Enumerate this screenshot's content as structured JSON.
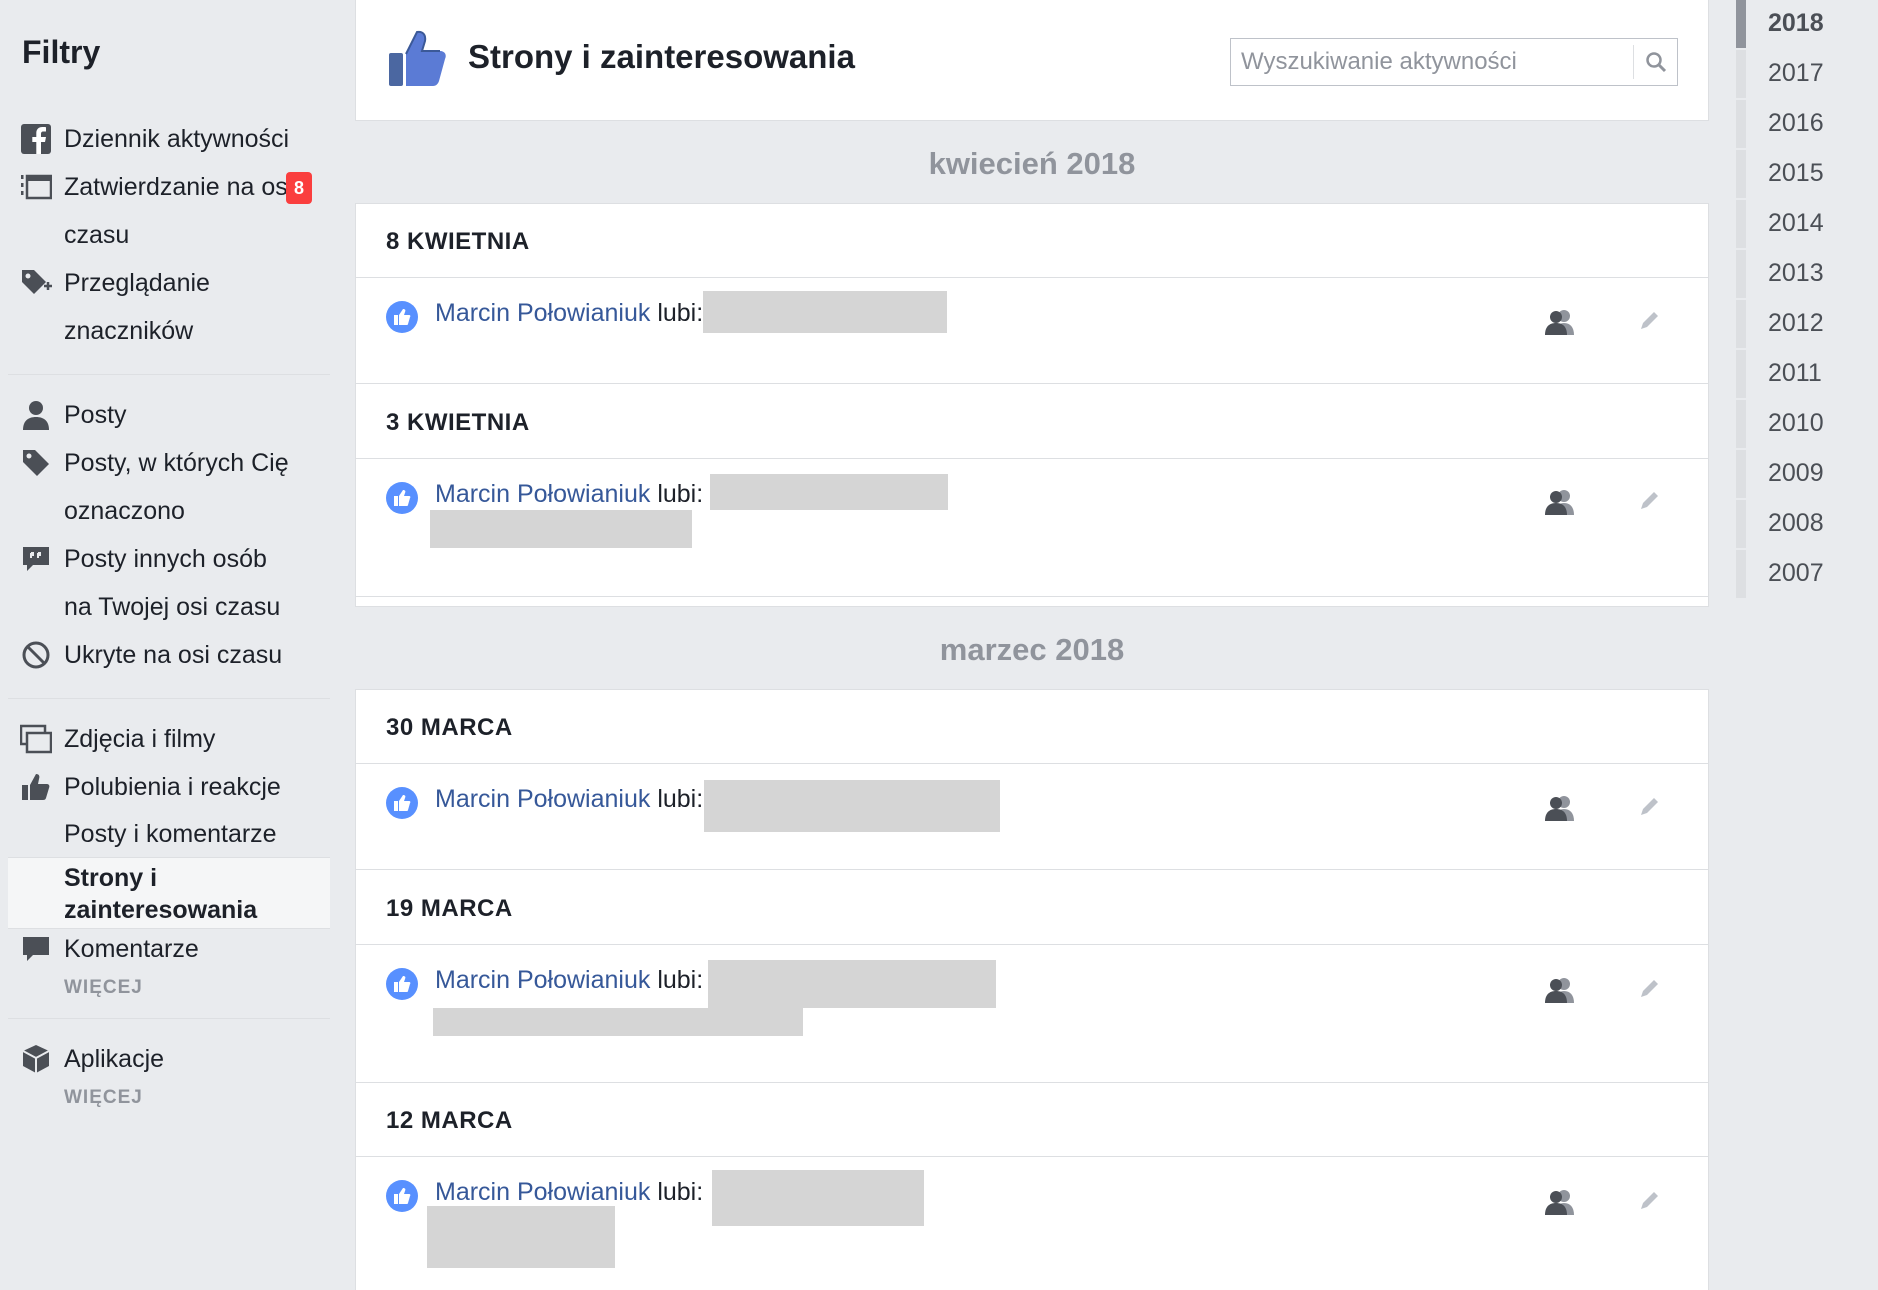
{
  "sidebar": {
    "title": "Filtry",
    "group1": [
      {
        "label": "Dziennik aktywności",
        "icon": "facebook-icon"
      },
      {
        "label": "Zatwierdzanie na osi czasu",
        "icon": "timeline-review-icon",
        "badge": "8"
      },
      {
        "label": "Przeglądanie znaczników",
        "icon": "tag-review-icon"
      }
    ],
    "group2": [
      {
        "label": "Posty",
        "icon": "person-icon"
      },
      {
        "label": "Posty, w których Cię oznaczono",
        "icon": "tag-icon"
      },
      {
        "label": "Posty innych osób na Twojej osi czasu",
        "icon": "quote-bubble-icon"
      },
      {
        "label": "Ukryte na osi czasu",
        "icon": "hidden-icon"
      }
    ],
    "group3": [
      {
        "label": "Zdjęcia i filmy",
        "icon": "photos-icon"
      },
      {
        "label": "Polubienia i reakcje",
        "icon": "like-icon"
      }
    ],
    "likes_sub": [
      {
        "label": "Posty i komentarze"
      },
      {
        "label": "Strony i zainteresowania",
        "active": true
      }
    ],
    "comments": {
      "label": "Komentarze",
      "icon": "comment-icon"
    },
    "more1": "WIĘCEJ",
    "apps": {
      "label": "Aplikacje",
      "icon": "apps-cube-icon"
    },
    "more2": "WIĘCEJ"
  },
  "header": {
    "title": "Strony i zainteresowania",
    "search_placeholder": "Wyszukiwanie aktywności"
  },
  "months": [
    {
      "label": "kwiecień 2018",
      "days": [
        {
          "date": "8 KWIETNIA",
          "entries": [
            {
              "actor": "Marcin Połowianiuk",
              "verb": " lubi:"
            }
          ]
        },
        {
          "date": "3 KWIETNIA",
          "entries": [
            {
              "actor": "Marcin Połowianiuk",
              "verb": " lubi:"
            }
          ]
        }
      ]
    },
    {
      "label": "marzec 2018",
      "days": [
        {
          "date": "30 MARCA",
          "entries": [
            {
              "actor": "Marcin Połowianiuk",
              "verb": " lubi:"
            }
          ]
        },
        {
          "date": "19 MARCA",
          "entries": [
            {
              "actor": "Marcin Połowianiuk",
              "verb": " lubi:"
            }
          ]
        },
        {
          "date": "12 MARCA",
          "entries": [
            {
              "actor": "Marcin Połowianiuk",
              "verb": " lubi:"
            }
          ]
        }
      ]
    }
  ],
  "years": [
    "2018",
    "2017",
    "2016",
    "2015",
    "2014",
    "2013",
    "2012",
    "2011",
    "2010",
    "2009",
    "2008",
    "2007"
  ],
  "active_year": "2018",
  "colors": {
    "link": "#365899",
    "badge": "#fa3e3e",
    "like": "#5890ff",
    "page_bg": "#e9ebee"
  }
}
